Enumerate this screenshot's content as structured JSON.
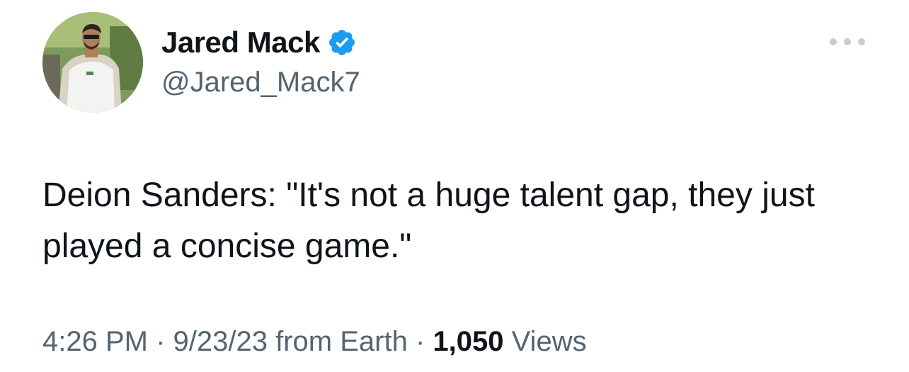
{
  "author": {
    "display_name": "Jared Mack",
    "handle": "@Jared_Mack7",
    "verified": true,
    "verified_icon": "verified-badge-icon",
    "verified_color": "#1d9bf0"
  },
  "menu": {
    "icon": "more-options-icon"
  },
  "tweet": {
    "text": "Deion Sanders: \"It's not a huge talent gap, they just played a concise game.\""
  },
  "meta": {
    "time": "4:26 PM",
    "separator_1": " · ",
    "date": "9/23/23",
    "source": " from Earth",
    "separator_2": " · ",
    "views_count": "1,050",
    "views_label": " Views"
  },
  "colors": {
    "text_primary": "#0f1419",
    "text_secondary": "#536471",
    "accent": "#1d9bf0"
  }
}
